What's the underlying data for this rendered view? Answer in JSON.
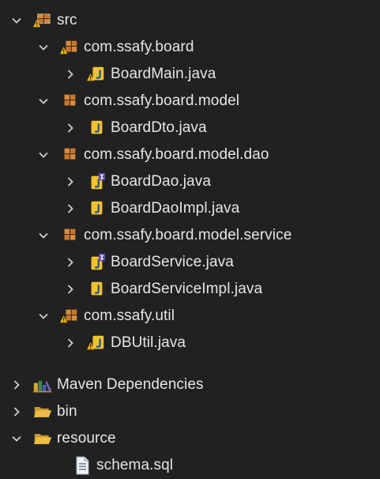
{
  "tree": {
    "src": "src",
    "pkg_board": "com.ssafy.board",
    "file_boardmain": "BoardMain.java",
    "pkg_model": "com.ssafy.board.model",
    "file_boarddto": "BoardDto.java",
    "pkg_dao": "com.ssafy.board.model.dao",
    "file_boarddao": "BoardDao.java",
    "file_boarddaoimpl": "BoardDaoImpl.java",
    "pkg_service": "com.ssafy.board.model.service",
    "file_boardservice": "BoardService.java",
    "file_boardserviceimpl": "BoardServiceImpl.java",
    "pkg_util": "com.ssafy.util",
    "file_dbutil": "DBUtil.java",
    "maven": "Maven Dependencies",
    "bin": "bin",
    "resource": "resource",
    "file_schema": "schema.sql"
  },
  "icons": {
    "package": "package-icon",
    "package_warning": "package-warning-icon",
    "java_class": "java-class-icon",
    "java_interface": "java-interface-icon",
    "folder_open": "folder-open-icon",
    "library": "library-icon",
    "text_file": "text-file-icon"
  },
  "colors": {
    "background": "#212121",
    "text": "#e6e6e6",
    "package": "#d98a3a",
    "java": "#f2c230",
    "java_letter": "#1d4f8f",
    "warning": "#f0b400",
    "folder": "#e8b23a"
  }
}
